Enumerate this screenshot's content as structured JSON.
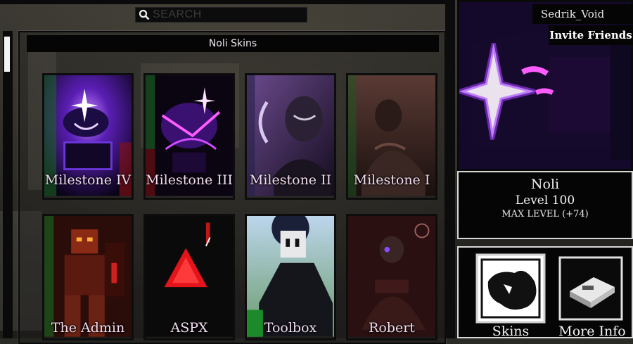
{
  "search": {
    "placeholder": "SEARCH",
    "icon": "search-icon"
  },
  "panel": {
    "title": "Noli Skins"
  },
  "skins": [
    {
      "label": "Milestone IV"
    },
    {
      "label": "Milestone III"
    },
    {
      "label": "Milestone II"
    },
    {
      "label": "Milestone I"
    },
    {
      "label": "The Admin"
    },
    {
      "label": "ASPX"
    },
    {
      "label": "Toolbox"
    },
    {
      "label": "Robert"
    }
  ],
  "player": {
    "username": "Sedrik_Void",
    "invite_label": "Invite Friends"
  },
  "character": {
    "name": "Noli",
    "level": "Level 100",
    "max_level": "MAX LEVEL (+74)"
  },
  "buttons": {
    "skins_label": "Skins",
    "more_info_label": "More Info"
  },
  "colors": {
    "panel_bg": "#050505",
    "text_pink": "#f0dcef",
    "accent_purple": "#a23cff",
    "aspx_red": "#e3141a"
  }
}
